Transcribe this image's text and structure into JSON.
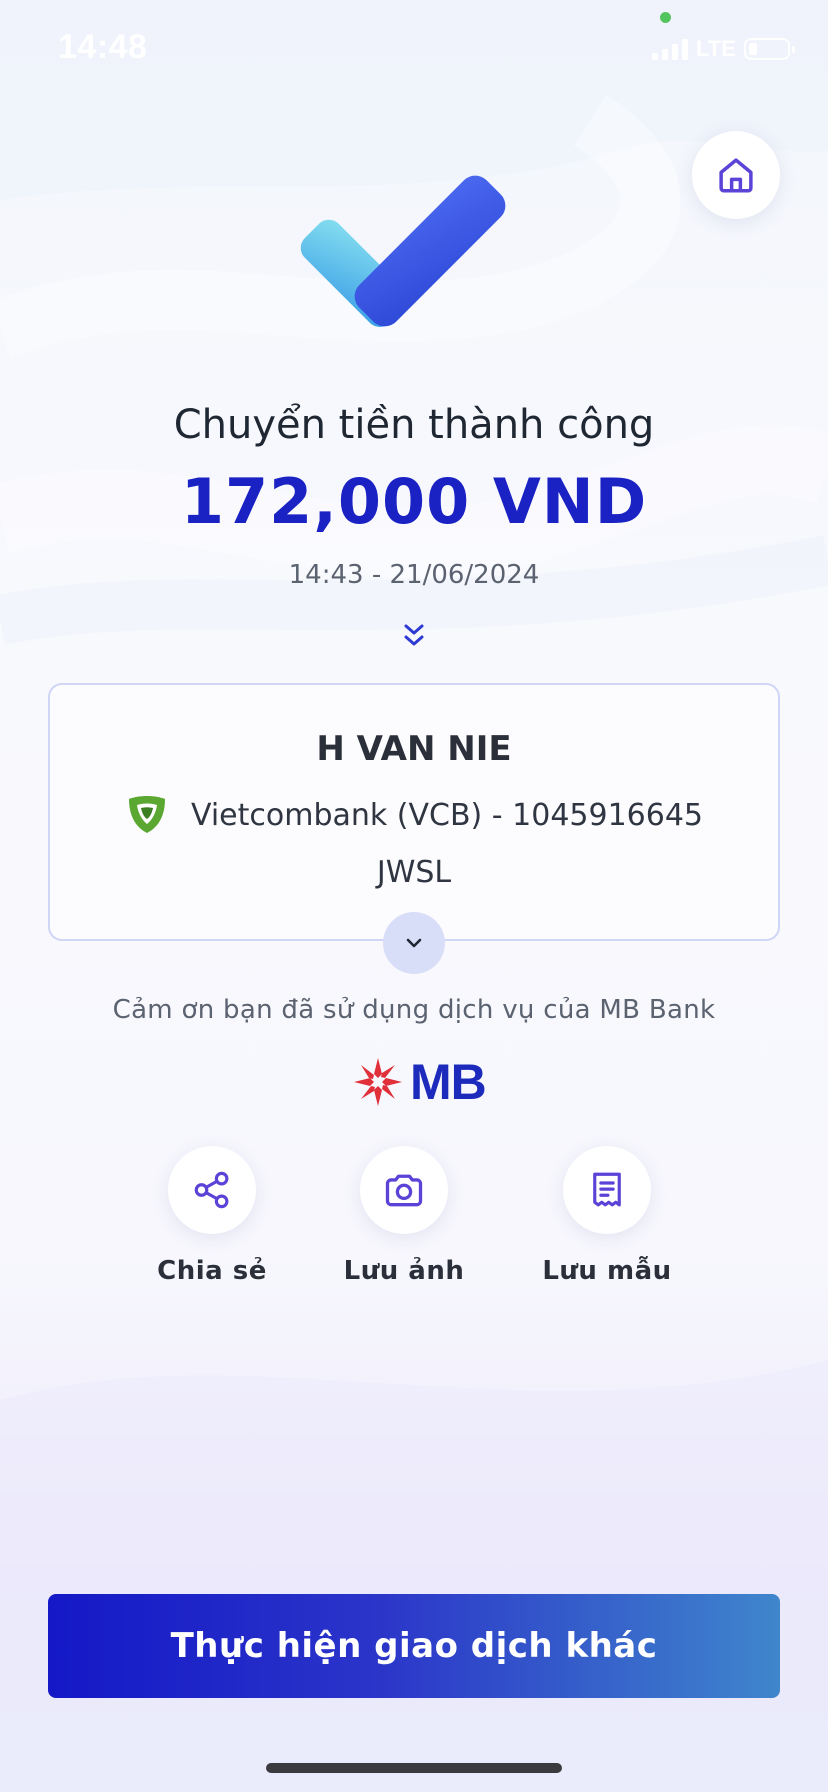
{
  "status_bar": {
    "time": "14:48",
    "network": "LTE"
  },
  "result": {
    "title": "Chuyển tiền thành công",
    "amount": "172,000 VND",
    "datetime": "14:43 - 21/06/2024"
  },
  "recipient": {
    "name": "H VAN NIE",
    "bank": "Vietcombank (VCB) - 1045916645",
    "memo": "JWSL"
  },
  "thanks_text": "Cảm ơn bạn đã sử dụng dịch vụ của MB Bank",
  "brand": {
    "logo_text": "MB"
  },
  "actions": [
    {
      "label": "Chia sẻ",
      "icon": "share-icon"
    },
    {
      "label": "Lưu ảnh",
      "icon": "camera-icon"
    },
    {
      "label": "Lưu mẫu",
      "icon": "receipt-icon"
    }
  ],
  "primary_button": {
    "label": "Thực hiện giao dịch khác"
  },
  "colors": {
    "accent": "#1b22c4",
    "icon": "#5a43d6",
    "vcb_green": "#5aa832",
    "mb_red": "#e0303a"
  }
}
